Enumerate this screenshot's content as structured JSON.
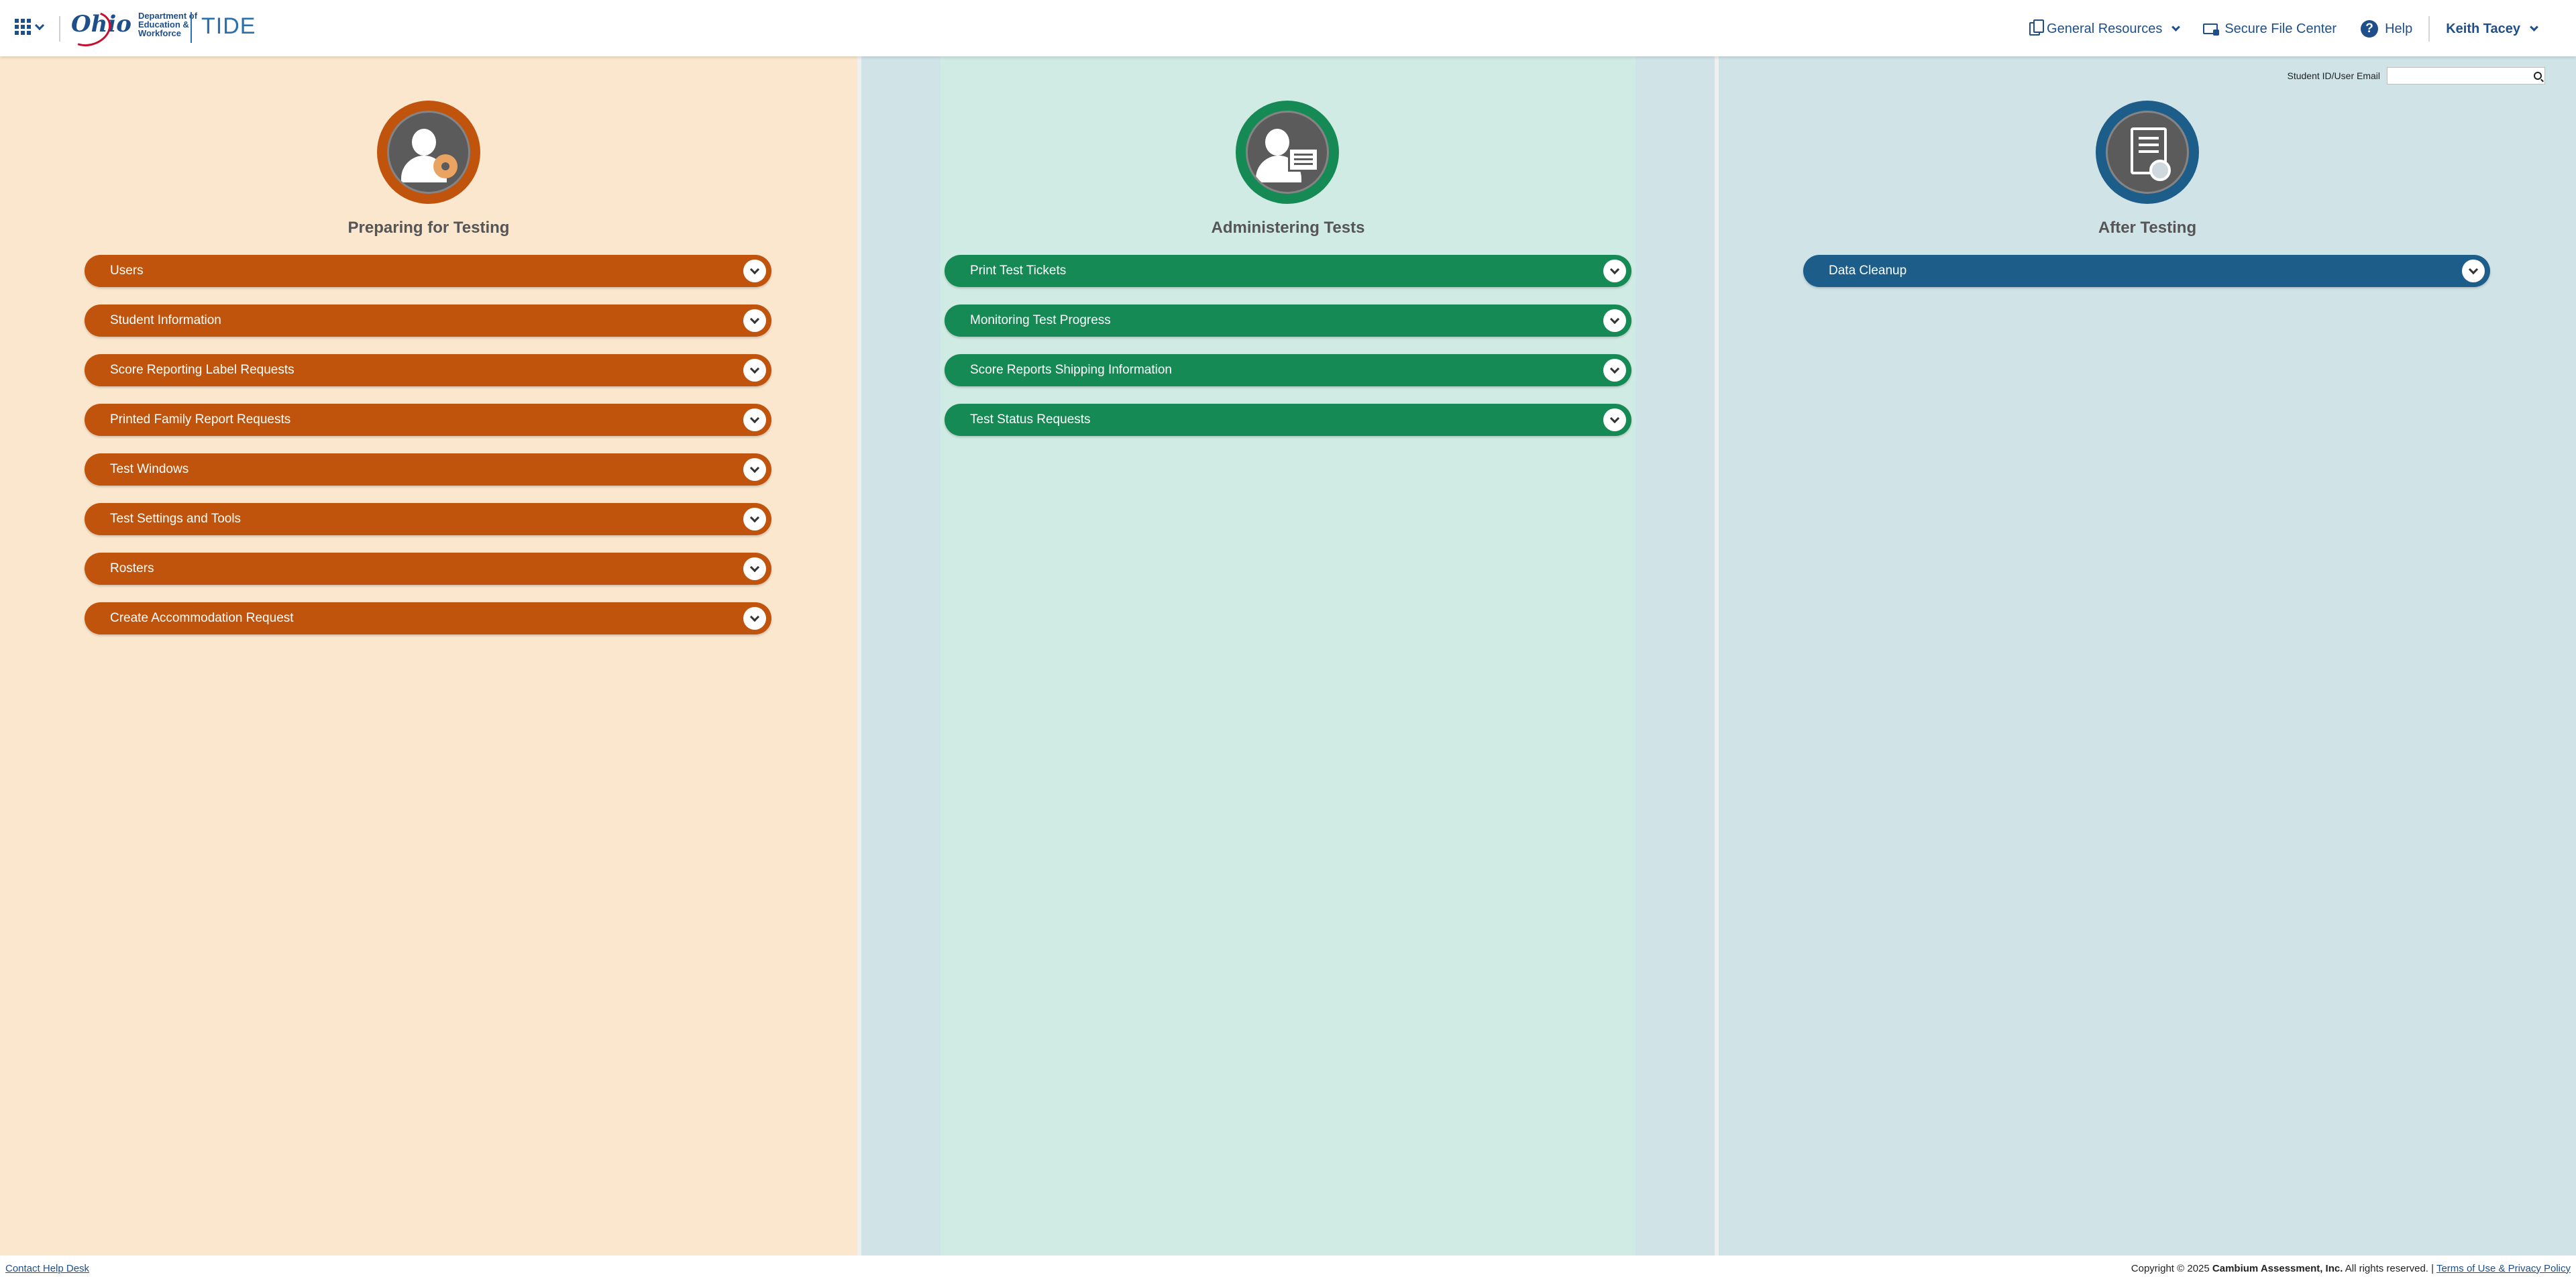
{
  "header": {
    "apps_icon": "grid-apps-icon",
    "logo_ohio": "Ohio",
    "logo_dept_line1": "Department of",
    "logo_dept_line2": "Education &",
    "logo_dept_line3": "Workforce",
    "app_title": "TIDE",
    "general_resources": "General Resources",
    "secure_file_center": "Secure File Center",
    "help": "Help",
    "user_name": "Keith Tacey"
  },
  "search": {
    "label": "Student ID/User Email",
    "value": "",
    "placeholder": ""
  },
  "columns": {
    "prep": {
      "title": "Preparing for Testing",
      "icon": "user-gear-icon",
      "color": "#c1540d",
      "items": [
        {
          "label": "Users"
        },
        {
          "label": "Student Information"
        },
        {
          "label": "Score Reporting Label Requests"
        },
        {
          "label": "Printed Family Report Requests"
        },
        {
          "label": "Test Windows"
        },
        {
          "label": "Test Settings and Tools"
        },
        {
          "label": "Rosters"
        },
        {
          "label": "Create Accommodation Request"
        }
      ]
    },
    "admin": {
      "title": "Administering Tests",
      "icon": "user-monitor-icon",
      "color": "#168a55",
      "items": [
        {
          "label": "Print Test Tickets"
        },
        {
          "label": "Monitoring Test Progress"
        },
        {
          "label": "Score Reports Shipping Information"
        },
        {
          "label": "Test Status Requests"
        }
      ]
    },
    "after": {
      "title": "After Testing",
      "icon": "certificate-icon",
      "color": "#1c5d8a",
      "items": [
        {
          "label": "Data Cleanup"
        }
      ]
    }
  },
  "footer": {
    "contact": "Contact Help Desk",
    "copyright_prefix": "Copyright © 2025",
    "company": "Cambium Assessment, Inc.",
    "rights": "All rights reserved.",
    "separator": "|",
    "terms": "Terms of Use & Privacy Policy"
  }
}
